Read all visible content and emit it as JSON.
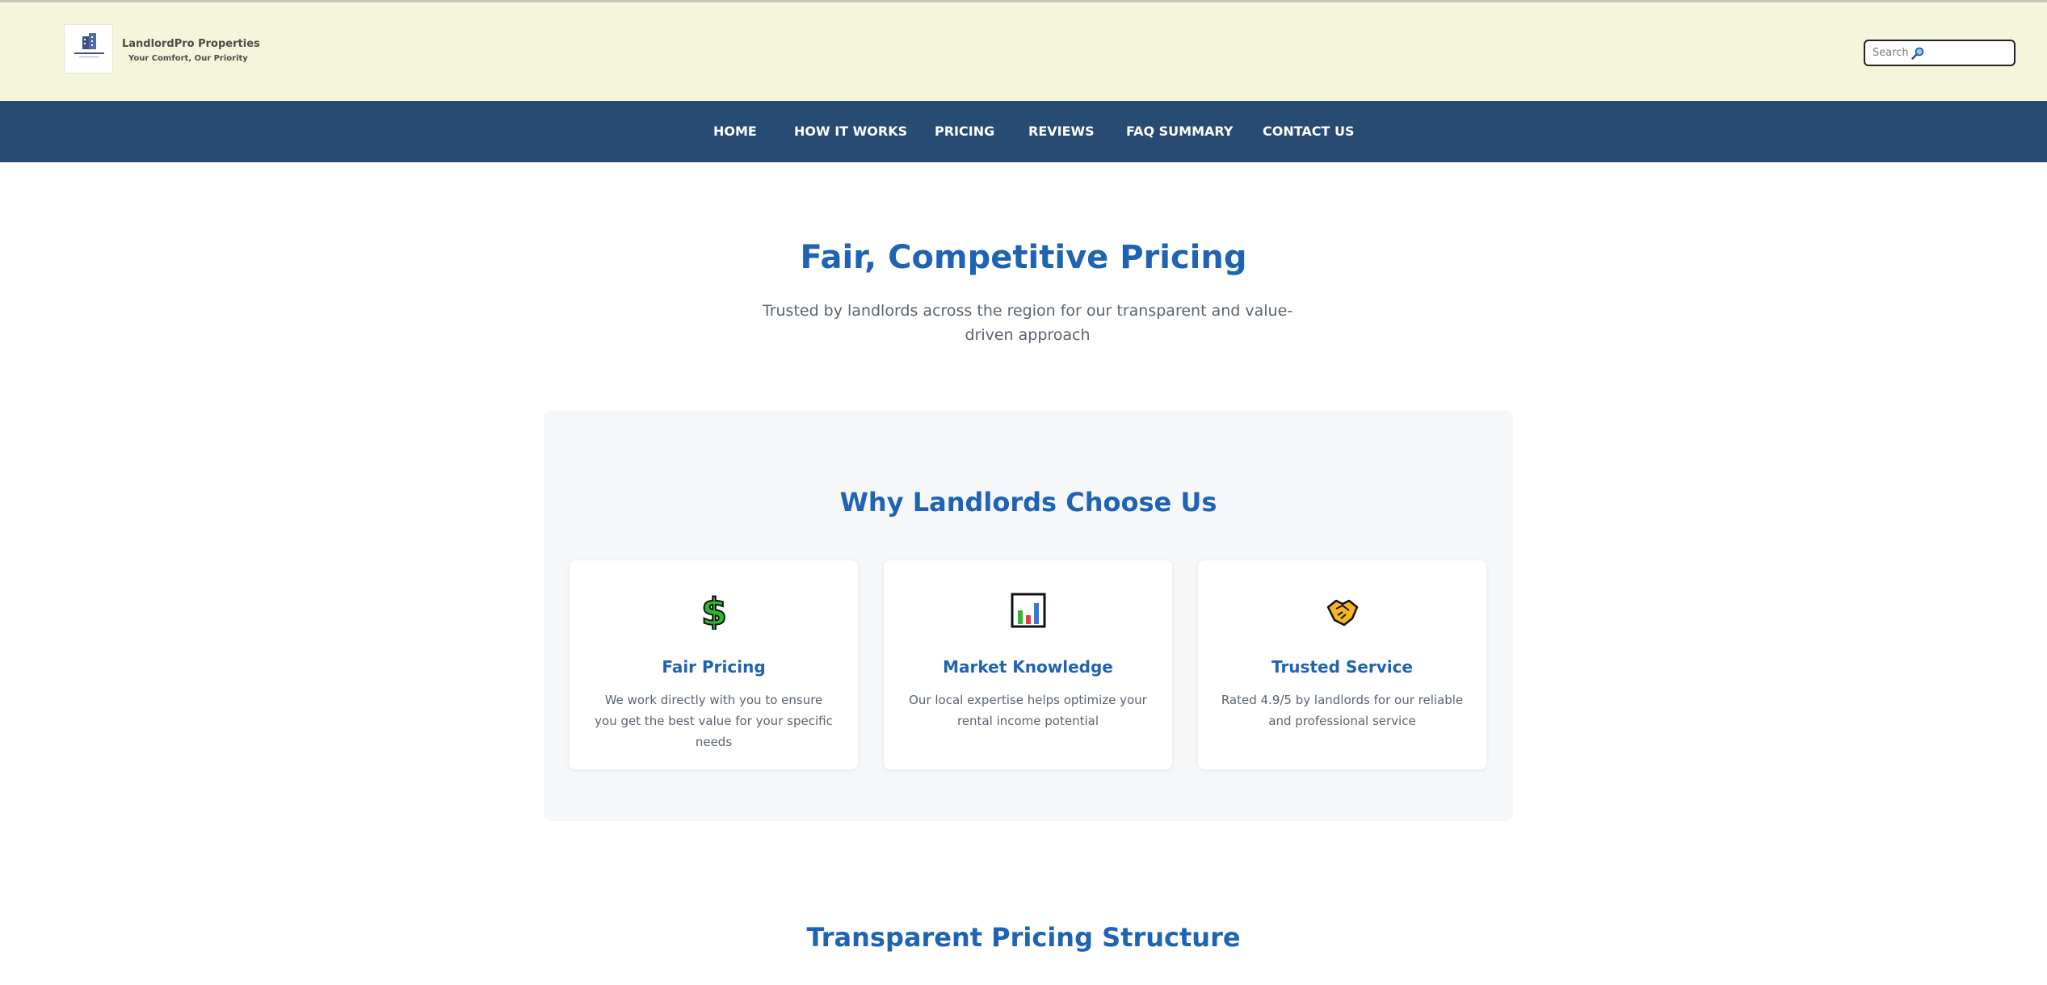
{
  "header": {
    "brand_name": "LandlordPro Properties",
    "tagline": "Your Comfort, Our Priority",
    "logo_icon": "building-logo",
    "search": {
      "placeholder": "Search",
      "icon": "magnifier-icon"
    }
  },
  "nav": {
    "items": [
      {
        "label": "HOME"
      },
      {
        "label": "HOW IT WORKS"
      },
      {
        "label": "PRICING"
      },
      {
        "label": "REVIEWS"
      },
      {
        "label": "FAQ SUMMARY"
      },
      {
        "label": "CONTACT US"
      }
    ]
  },
  "hero": {
    "title": "Fair, Competitive Pricing",
    "subtitle": "Trusted by landlords across the region for our transparent and value-driven approach"
  },
  "why": {
    "title": "Why Landlords Choose Us",
    "cards": [
      {
        "icon": "dollar-icon",
        "title": "Fair Pricing",
        "text": "We work directly with you to ensure you get the best value for your specific needs"
      },
      {
        "icon": "bar-chart-icon",
        "title": "Market Knowledge",
        "text": "Our local expertise helps optimize your rental income potential"
      },
      {
        "icon": "handshake-icon",
        "title": "Trusted Service",
        "text": "Rated 4.9/5 by landlords for our reliable and professional service"
      }
    ]
  },
  "pricing_section": {
    "title": "Transparent Pricing Structure"
  },
  "colors": {
    "topbar_bg": "#f5f5db",
    "nav_bg": "#284b73",
    "accent_blue": "#1e63b4",
    "panel_bg": "#f5f7f9"
  }
}
